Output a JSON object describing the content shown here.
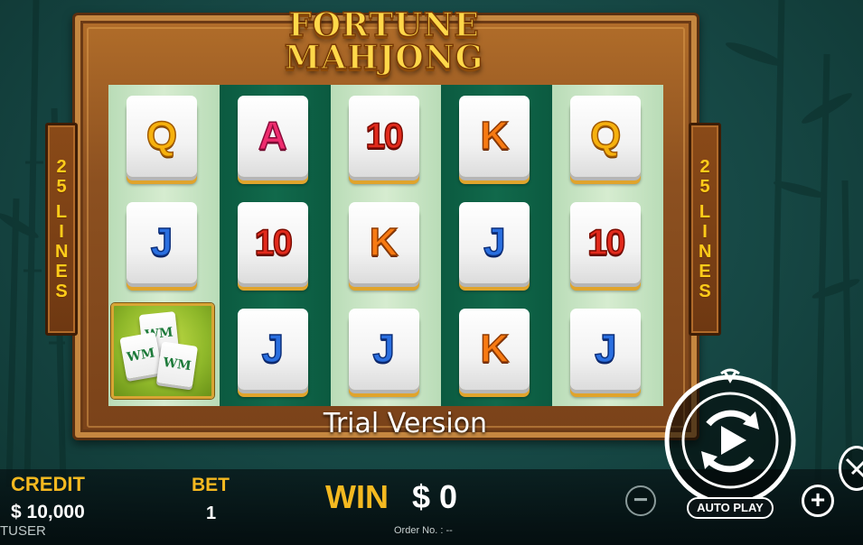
{
  "game": {
    "title_line1": "FORTUNE",
    "title_line2": "MAHJONG",
    "paylines_number": "25",
    "paylines_word": "LINES",
    "trial_notice": "Trial Version"
  },
  "reels": [
    {
      "symbols": [
        {
          "text": "Q",
          "color": "gold"
        },
        {
          "text": "J",
          "color": "blue"
        },
        {
          "text": "",
          "color": "scatter",
          "icon": "mahjong-tiles-icon"
        }
      ]
    },
    {
      "symbols": [
        {
          "text": "A",
          "color": "pink"
        },
        {
          "text": "10",
          "color": "red"
        },
        {
          "text": "J",
          "color": "blue"
        }
      ]
    },
    {
      "symbols": [
        {
          "text": "10",
          "color": "red"
        },
        {
          "text": "K",
          "color": "orange"
        },
        {
          "text": "J",
          "color": "blue"
        }
      ]
    },
    {
      "symbols": [
        {
          "text": "K",
          "color": "orange"
        },
        {
          "text": "J",
          "color": "blue"
        },
        {
          "text": "K",
          "color": "orange"
        }
      ]
    },
    {
      "symbols": [
        {
          "text": "Q",
          "color": "gold"
        },
        {
          "text": "10",
          "color": "red"
        },
        {
          "text": "J",
          "color": "blue"
        }
      ]
    }
  ],
  "scatter_tile_glyph": "WM",
  "bottom_bar": {
    "credit_label": "CREDIT",
    "credit_value": "$ 10,000",
    "user_label": "TUSER",
    "bet_label": "BET",
    "bet_value": "1",
    "win_label": "WIN",
    "win_value": "$ 0",
    "order_label": "Order No. : --",
    "minus_glyph": "−",
    "plus_glyph": "+",
    "autoplay_label": "AUTO PLAY"
  },
  "colors": {
    "accent_gold": "#f5b920",
    "frame_wood": "#8c5020",
    "reel_light": "#d6ecd0",
    "reel_dark": "#11694b",
    "background": "#164744"
  },
  "icons": {
    "spin": "spin-play-icon",
    "settings": "settings-icon",
    "minus": "minus-icon",
    "plus": "plus-icon"
  }
}
